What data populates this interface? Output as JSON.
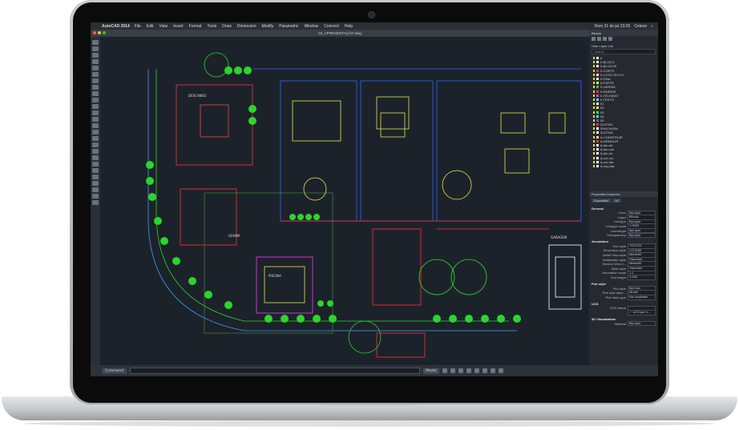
{
  "menubar": {
    "app_name": "AutoCAD 2014",
    "items": [
      "File",
      "Edit",
      "View",
      "Insert",
      "Format",
      "Tools",
      "Draw",
      "Dimension",
      "Modify",
      "Parametric",
      "Window",
      "Connect",
      "Help"
    ],
    "clock": "Dom 31 de jul  23:25",
    "user": "Celeon"
  },
  "window": {
    "title": "03_APRESENTAÇÃO.dwg"
  },
  "drawing_labels": {
    "deck": "DESCANSO",
    "pool": "PISCINA",
    "yard": "GRAMA",
    "carport": "GARAGEM"
  },
  "layers_panel": {
    "header": "Blocos",
    "title": "Hide Layer List",
    "search_placeholder": "Search",
    "layers": [
      {
        "name": "0",
        "color": "#ffffff"
      },
      {
        "name": "0-BLOCO",
        "color": "#ffffff"
      },
      {
        "name": "0-BLOCOS",
        "color": "#ffffff"
      },
      {
        "name": "0-CORTE",
        "color": "#ff3333"
      },
      {
        "name": "0-COTA-TEXTO",
        "color": "#ffffff"
      },
      {
        "name": "0-FINA",
        "color": "#ffffff"
      },
      {
        "name": "0-FORTE",
        "color": "#ffff33"
      },
      {
        "name": "0-JARDIM",
        "color": "#33cc33"
      },
      {
        "name": "0-PAREDE",
        "color": "#ff3333"
      },
      {
        "name": "0-TELHADO",
        "color": "#ff33ff"
      },
      {
        "name": "0-TEXTO",
        "color": "#33ffff"
      },
      {
        "name": "01",
        "color": "#ffffff"
      },
      {
        "name": "02",
        "color": "#ffff33"
      },
      {
        "name": "03",
        "color": "#33ff33"
      },
      {
        "name": "04",
        "color": "#33ffff"
      },
      {
        "name": "05",
        "color": "#3366ff"
      },
      {
        "name": "3COTAS",
        "color": "#ff3333"
      },
      {
        "name": "3HACHURA",
        "color": "#ffffff"
      },
      {
        "name": "3COTAS",
        "color": "#ffffff"
      },
      {
        "name": "A-CONSTRUIR",
        "color": "#ffff33"
      },
      {
        "name": "A-DEMOLIR",
        "color": "#ff3333"
      },
      {
        "name": "A-alv-alv",
        "color": "#ffffff"
      },
      {
        "name": "A-alv-corr",
        "color": "#ffffff"
      },
      {
        "name": "A-alv-viv",
        "color": "#ffffff"
      },
      {
        "name": "A-cor-crs",
        "color": "#ffffff"
      },
      {
        "name": "A-cor-lda",
        "color": "#ffffff"
      },
      {
        "name": "A-equ-lda",
        "color": "#ffffff"
      }
    ]
  },
  "properties": {
    "title": "Properties Inspector",
    "tabs": [
      "Essentials",
      "All"
    ],
    "general": {
      "section": "General",
      "rows": [
        {
          "label": "Color",
          "value": "ByLayer"
        },
        {
          "label": "Layer",
          "value": "Blocos"
        },
        {
          "label": "Linetype",
          "value": "ByLayer"
        },
        {
          "label": "Linetype scale",
          "value": "1.0000"
        },
        {
          "label": "Lineweight",
          "value": "ByLayer"
        },
        {
          "label": "Transparency",
          "value": "ByLayer"
        }
      ]
    },
    "annotation": {
      "section": "Annotation",
      "rows": [
        {
          "label": "Text style",
          "value": "TEXTO3"
        },
        {
          "label": "Dimension style",
          "value": "COTA50"
        },
        {
          "label": "Detail View style",
          "value": "Metric50"
        },
        {
          "label": "Multileader style",
          "value": "Standard"
        },
        {
          "label": "Section View s...",
          "value": "Metric50"
        },
        {
          "label": "Table style",
          "value": "Standard"
        },
        {
          "label": "Annotation scale",
          "value": "1:1"
        },
        {
          "label": "Text height",
          "value": "1.000"
        }
      ]
    },
    "plot": {
      "section": "Plot style",
      "rows": [
        {
          "label": "Plot style",
          "value": "ByColor"
        },
        {
          "label": "Plot style attac...",
          "value": "Model"
        },
        {
          "label": "Plot table type",
          "value": "Not available"
        }
      ]
    },
    "ucs": {
      "section": "UCS",
      "rows": [
        {
          "label": "UCS Name",
          "value": ""
        },
        {
          "label": "",
          "value": "✓ UCS per v..."
        }
      ]
    },
    "viz": {
      "section": "3D Visualization",
      "rows": [
        {
          "label": "Material",
          "value": "ByLayer"
        }
      ]
    }
  },
  "commandline": {
    "label": "Command",
    "model_tab": "Model"
  }
}
